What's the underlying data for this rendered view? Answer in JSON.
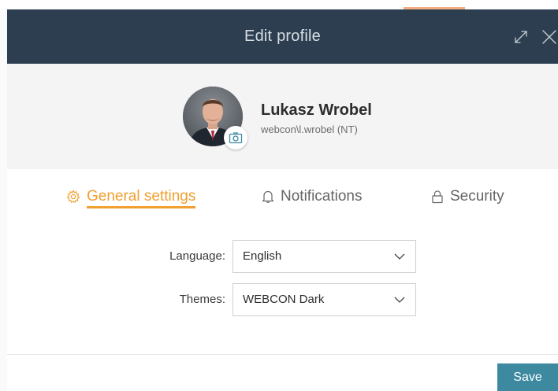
{
  "dialog": {
    "title": "Edit profile",
    "expand_icon": "expand-arrows-icon",
    "close_icon": "close-x-icon"
  },
  "profile": {
    "name": "Lukasz Wrobel",
    "login": "webcon\\l.wrobel (NT)",
    "camera_icon": "camera-icon"
  },
  "tabs": [
    {
      "label": "General settings",
      "icon": "gear-icon",
      "active": true
    },
    {
      "label": "Notifications",
      "icon": "bell-icon",
      "active": false
    },
    {
      "label": "Security",
      "icon": "lock-icon",
      "active": false
    }
  ],
  "form": {
    "language": {
      "label": "Language:",
      "value": "English"
    },
    "themes": {
      "label": "Themes:",
      "value": "WEBCON Dark"
    }
  },
  "footer": {
    "save_label": "Save"
  },
  "colors": {
    "header_bg": "#2c3e50",
    "accent": "#f0a030",
    "save_bg": "#3d8aa0",
    "profile_band_bg": "#f4f4f4"
  }
}
